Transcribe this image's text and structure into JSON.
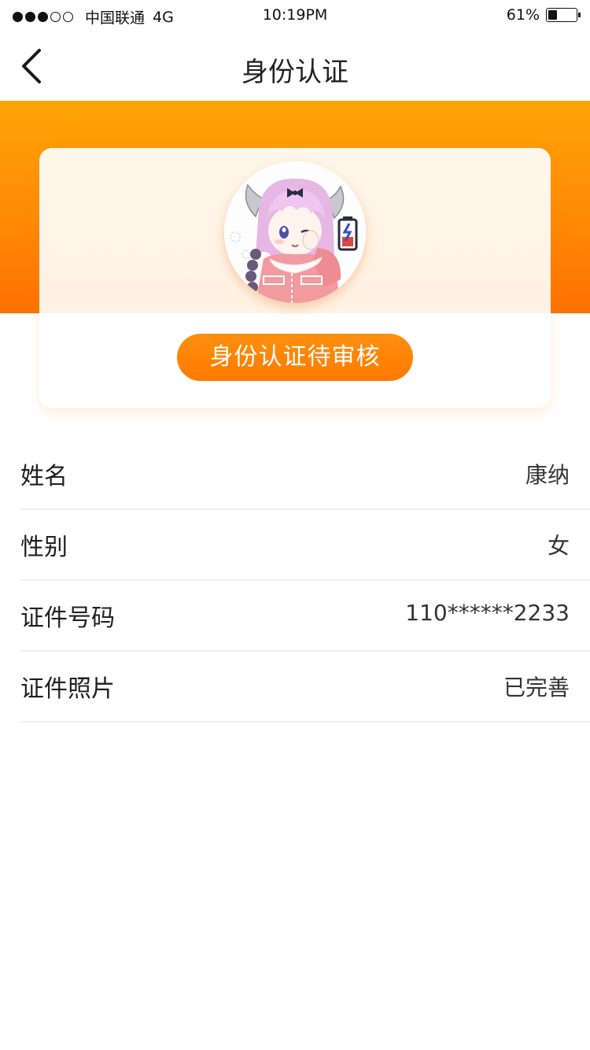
{
  "status_bar": {
    "carrier": "中国联通",
    "network": "4G",
    "time": "10:19PM",
    "battery_percent": "61%",
    "battery_level": 0.61,
    "signal_dots_filled": 3,
    "signal_dots_total": 5
  },
  "nav": {
    "title": "身份认证",
    "back_icon": "chevron-left-icon"
  },
  "profile": {
    "avatar_icon": "anime-girl-avatar",
    "status_button_label": "身份认证待审核"
  },
  "info_rows": [
    {
      "label": "姓名",
      "value": "康纳"
    },
    {
      "label": "性别",
      "value": "女"
    },
    {
      "label": "证件号码",
      "value": "110******2233"
    },
    {
      "label": "证件照片",
      "value": "已完善"
    }
  ],
  "colors": {
    "accent_orange": "#ff8000",
    "header_gradient_top": "#ffa407",
    "header_gradient_bottom": "#ff7000"
  }
}
